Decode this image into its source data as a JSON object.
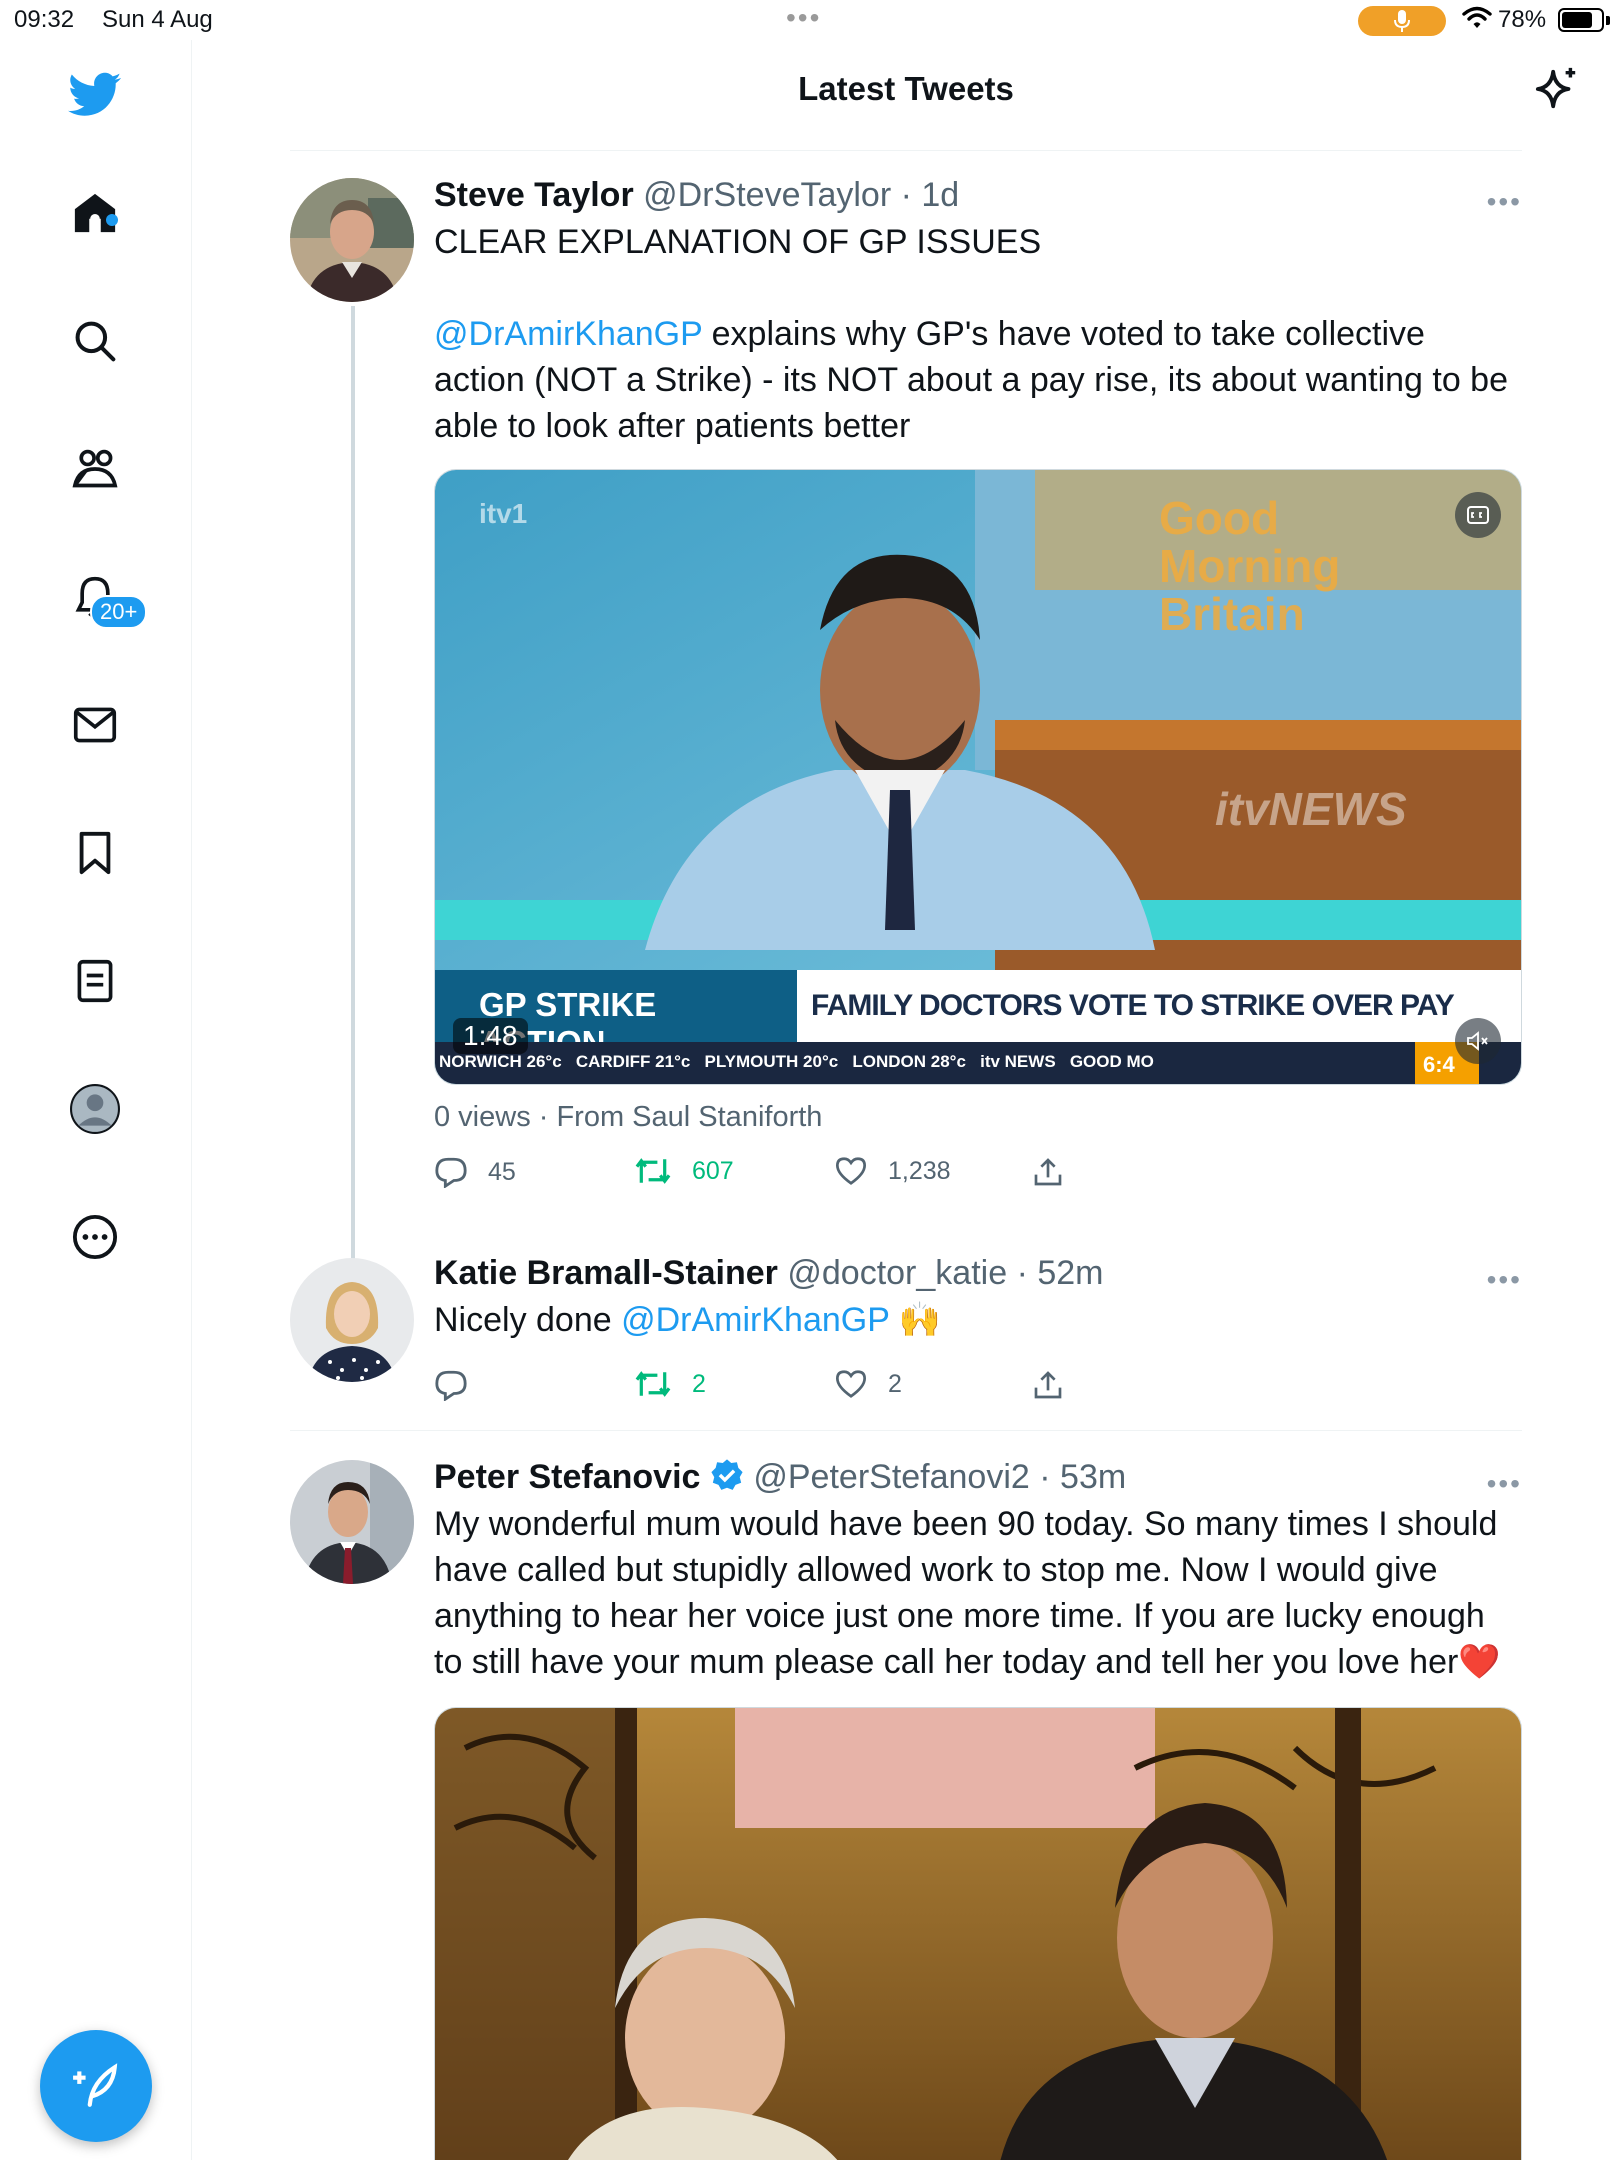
{
  "status": {
    "time": "09:32",
    "date": "Sun 4 Aug",
    "battery": "78%"
  },
  "sidebar": {
    "notifications_badge": "20+",
    "icons": [
      "twitter-logo-icon",
      "home-icon",
      "search-icon",
      "communities-icon",
      "bell-icon",
      "mail-icon",
      "bookmark-icon",
      "lists-icon",
      "profile-icon",
      "more-icon",
      "compose-icon"
    ]
  },
  "header": {
    "title": "Latest Tweets"
  },
  "tweets": [
    {
      "name": "Steve Taylor",
      "handle": "@DrSteveTaylor",
      "time": "· 1d",
      "text_line1": "CLEAR EXPLANATION OF GP ISSUES",
      "mention": "@DrAmirKhanGP",
      "text_rest": " explains why GP's have voted to take collective action (NOT a Strike) - its NOT about a pay rise, its about wanting to be able to look after patients better",
      "video": {
        "channel": "itv1",
        "show": "Good Morning Britain",
        "studio_logo": "itvNEWS",
        "strap_left": "GP STRIKE ACTION",
        "strap_right": "FAMILY DOCTORS VOTE TO STRIKE OVER PAY",
        "duration": "1:48",
        "clock": "6:4",
        "ticker": "NORWICH 26°c   CARDIFF 21°c   PLYMOUTH 20°c   LONDON 28°c   itv NEWS   GOOD MO"
      },
      "meta": "0 views · From Saul Staniforth",
      "replies": "45",
      "retweets": "607",
      "likes": "1,238"
    },
    {
      "name": "Katie Bramall-Stainer",
      "handle": "@doctor_katie",
      "time": "· 52m",
      "text_prefix": "Nicely done ",
      "mention": "@DrAmirKhanGP",
      "emoji": "🙌",
      "replies": "",
      "retweets": "2",
      "likes": "2"
    },
    {
      "name": "Peter Stefanovic",
      "handle": "@PeterStefanovi2",
      "time": "· 53m",
      "text": "My wonderful mum would have been 90 today. So many times I should have called but stupidly allowed work to stop me. Now I would give anything to hear her voice just one more time. If you are lucky enough to still have your mum please call her today and tell her you love her",
      "emoji": "❤️"
    }
  ],
  "colors": {
    "accent": "#1d9bf0",
    "retweet": "#00ba7c",
    "secondary_text": "#536471"
  }
}
